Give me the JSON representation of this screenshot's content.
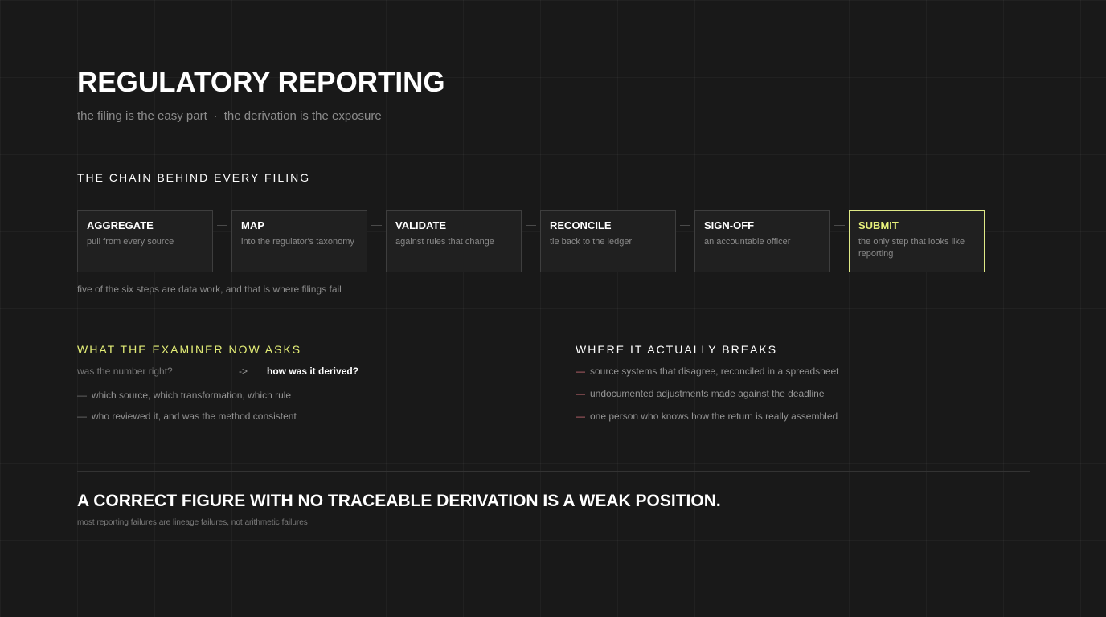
{
  "header": {
    "title": "REGULATORY REPORTING",
    "subtitle_left": "the filing is the easy part",
    "subtitle_separator": "·",
    "subtitle_right": "the derivation is the exposure"
  },
  "chain": {
    "heading": "THE CHAIN BEHIND EVERY FILING",
    "steps": [
      {
        "name": "AGGREGATE",
        "desc": "pull from every source"
      },
      {
        "name": "MAP",
        "desc": "into the regulator's taxonomy"
      },
      {
        "name": "VALIDATE",
        "desc": "against rules that change"
      },
      {
        "name": "RECONCILE",
        "desc": "tie back to the ledger"
      },
      {
        "name": "SIGN-OFF",
        "desc": "an accountable officer"
      },
      {
        "name": "SUBMIT",
        "desc": "the only step that looks like reporting",
        "highlighted": true
      }
    ],
    "note": "five of the six steps are data work, and that is where filings fail"
  },
  "examiner": {
    "heading": "WHAT THE EXAMINER NOW ASKS",
    "old_question": "was the number right?",
    "arrow": "->",
    "new_question": "how was it derived?",
    "items": [
      "which source, which transformation, which rule",
      "who reviewed it, and was the method consistent"
    ]
  },
  "breaks": {
    "heading": "WHERE IT ACTUALLY BREAKS",
    "items": [
      "source systems that disagree, reconciled in a spreadsheet",
      "undocumented adjustments made against the deadline",
      "one person who knows how the return is really assembled"
    ]
  },
  "footer": {
    "statement": "A CORRECT FIGURE WITH NO TRACEABLE DERIVATION IS A WEAK POSITION.",
    "note": "most reporting failures are lineage failures, not arithmetic failures"
  },
  "colors": {
    "background": "#191919",
    "accent": "#e4ee77",
    "break_marker": "#c96a73"
  }
}
